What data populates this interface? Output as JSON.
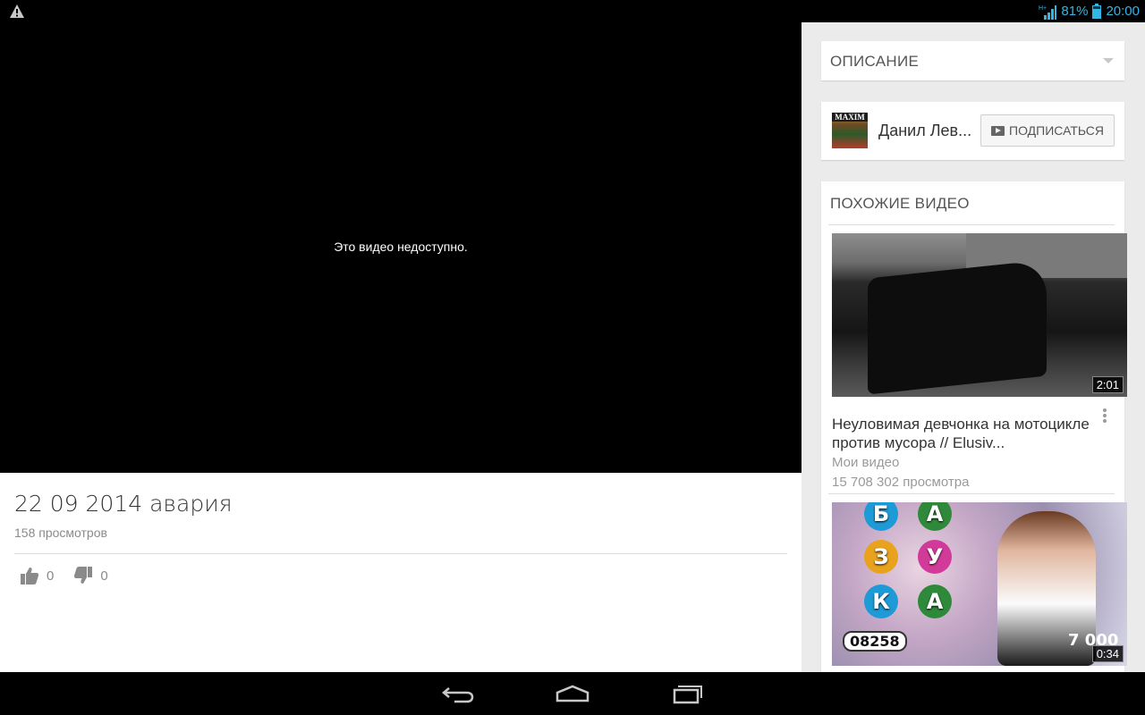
{
  "status_bar": {
    "warning_icon": "warning-icon",
    "network_label": "H+",
    "battery": "81%",
    "time": "20:00",
    "accent_color": "#33b5e5"
  },
  "player": {
    "message": "Это видео недоступно."
  },
  "video": {
    "title": "22 09 2014 авария",
    "views": "158 просмотров",
    "likes": "0",
    "dislikes": "0"
  },
  "description_section": {
    "title": "ОПИСАНИЕ"
  },
  "channel": {
    "avatar_text": "MAXIM",
    "name": "Данил Лев...",
    "subscribe_label": "ПОДПИСАТЬСЯ"
  },
  "related": {
    "title": "ПОХОЖИЕ ВИДЕО",
    "items": [
      {
        "duration": "2:01",
        "title": "Неуловимая девчонка на мотоцикле против мусора // Elusiv...",
        "channel": "Мои видео",
        "views": "15 708 302 просмотра"
      },
      {
        "duration": "0:34",
        "balls": [
          "Б",
          "А",
          "З",
          "У",
          "К",
          "А"
        ],
        "score": "08258",
        "prize": "7 000"
      }
    ]
  },
  "nav_bar": {
    "buttons": [
      "back-icon",
      "home-icon",
      "recent-apps-icon"
    ]
  }
}
